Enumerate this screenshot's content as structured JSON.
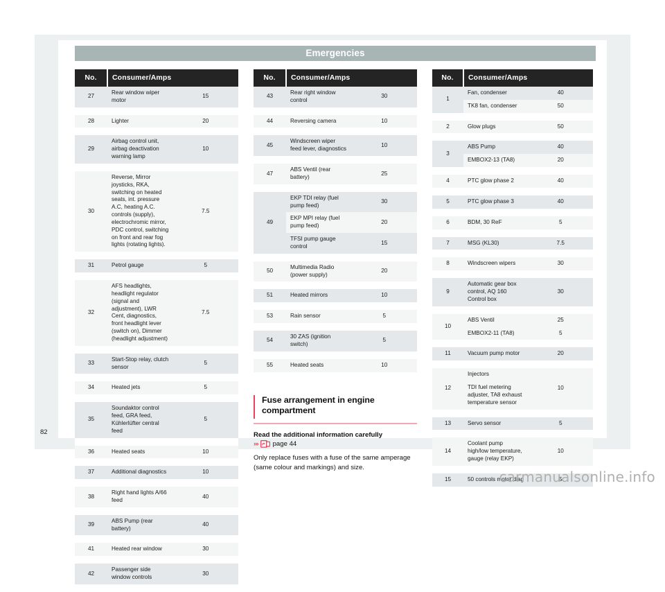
{
  "header": {
    "chapter_title": "Emergencies"
  },
  "folio": {
    "page_number": "82"
  },
  "watermark": {
    "text": "carmanualsonline.info"
  },
  "table_headers": {
    "no": "No.",
    "consumer": "Consumer/Amps"
  },
  "colors": {
    "header_bar": "#a7b5b5",
    "table_header": "#242424",
    "accent_red": "#e8415a",
    "row_dark": "#e4e8ea",
    "row_light": "#f4f6f6",
    "page_backdrop": "#edf0f1"
  },
  "tables": [
    {
      "id": "fuse-table-1",
      "rows": [
        {
          "no": "27",
          "items": [
            {
              "name": "Rear window wiper motor",
              "amps": "15"
            }
          ]
        },
        {
          "no": "28",
          "items": [
            {
              "name": "Lighter",
              "amps": "20"
            }
          ]
        },
        {
          "no": "29",
          "items": [
            {
              "name": "Airbag control unit, airbag deactivation warning lamp",
              "amps": "10"
            }
          ]
        },
        {
          "no": "30",
          "items": [
            {
              "name": "Reverse, Mirror joysticks, RKA, switching on heated seats, int. pressure A.C, heating A.C. controls (supply), electrochromic mirror, PDC control, switching on front and rear fog lights (rotating lights).",
              "amps": "7.5"
            }
          ]
        },
        {
          "no": "31",
          "items": [
            {
              "name": "Petrol gauge",
              "amps": "5"
            }
          ]
        },
        {
          "no": "32",
          "items": [
            {
              "name": "AFS headlights, headlight regulator (signal and adjustment), LWR Cent, diagnostics, front headlight lever (switch on), Dimmer (headlight adjustment)",
              "amps": "7.5"
            }
          ]
        },
        {
          "no": "33",
          "items": [
            {
              "name": "Start-Stop relay, clutch sensor",
              "amps": "5"
            }
          ]
        },
        {
          "no": "34",
          "items": [
            {
              "name": "Heated jets",
              "amps": "5"
            }
          ]
        },
        {
          "no": "35",
          "items": [
            {
              "name": "Soundaktor control feed, GRA feed, Kühlerlüfter central feed",
              "amps": "5"
            }
          ]
        },
        {
          "no": "36",
          "items": [
            {
              "name": "Heated seats",
              "amps": "10"
            }
          ]
        },
        {
          "no": "37",
          "items": [
            {
              "name": "Additional diagnostics",
              "amps": "10"
            }
          ]
        },
        {
          "no": "38",
          "items": [
            {
              "name": "Right hand lights A/66 feed",
              "amps": "40"
            }
          ]
        },
        {
          "no": "39",
          "items": [
            {
              "name": "ABS Pump (rear battery)",
              "amps": "40"
            }
          ]
        },
        {
          "no": "41",
          "items": [
            {
              "name": "Heated rear window",
              "amps": "30"
            }
          ]
        },
        {
          "no": "42",
          "items": [
            {
              "name": "Passenger side window controls",
              "amps": "30"
            }
          ]
        }
      ]
    },
    {
      "id": "fuse-table-2",
      "rows": [
        {
          "no": "43",
          "items": [
            {
              "name": "Rear right window control",
              "amps": "30"
            }
          ]
        },
        {
          "no": "44",
          "items": [
            {
              "name": "Reversing camera",
              "amps": "10"
            }
          ]
        },
        {
          "no": "45",
          "items": [
            {
              "name": "Windscreen wiper feed lever, diagnostics",
              "amps": "10"
            }
          ]
        },
        {
          "no": "47",
          "items": [
            {
              "name": "ABS Ventil (rear battery)",
              "amps": "25"
            }
          ]
        },
        {
          "no": "49",
          "items": [
            {
              "name": "EKP TDI relay (fuel pump feed)",
              "amps": "30"
            },
            {
              "name": "EKP MPI relay (fuel pump feed)",
              "amps": "20"
            },
            {
              "name": "TFSI pump gauge control",
              "amps": "15"
            }
          ]
        },
        {
          "no": "50",
          "items": [
            {
              "name": "Multimedia Radio (power supply)",
              "amps": "20"
            }
          ]
        },
        {
          "no": "51",
          "items": [
            {
              "name": "Heated mirrors",
              "amps": "10"
            }
          ]
        },
        {
          "no": "53",
          "items": [
            {
              "name": "Rain sensor",
              "amps": "5"
            }
          ]
        },
        {
          "no": "54",
          "items": [
            {
              "name": "30 ZAS (ignition switch)",
              "amps": "5"
            }
          ]
        },
        {
          "no": "55",
          "items": [
            {
              "name": "Heated seats",
              "amps": "10"
            }
          ]
        }
      ]
    },
    {
      "id": "fuse-table-3",
      "rows": [
        {
          "no": "1",
          "items": [
            {
              "name": "Fan, condenser",
              "amps": "40"
            },
            {
              "name": "TK8 fan, condenser",
              "amps": "50"
            }
          ]
        },
        {
          "no": "2",
          "items": [
            {
              "name": "Glow plugs",
              "amps": "50"
            }
          ]
        },
        {
          "no": "3",
          "items": [
            {
              "name": "ABS Pump",
              "amps": "40"
            },
            {
              "name": "EMBOX2-13 (TA8)",
              "amps": "20"
            }
          ]
        },
        {
          "no": "4",
          "items": [
            {
              "name": "PTC glow phase 2",
              "amps": "40"
            }
          ]
        },
        {
          "no": "5",
          "items": [
            {
              "name": "PTC glow phase 3",
              "amps": "40"
            }
          ]
        },
        {
          "no": "6",
          "items": [
            {
              "name": "BDM, 30 ReF",
              "amps": "5"
            }
          ]
        },
        {
          "no": "7",
          "items": [
            {
              "name": "MSG (KL30)",
              "amps": "7.5"
            }
          ]
        },
        {
          "no": "8",
          "items": [
            {
              "name": "Windscreen wipers",
              "amps": "30"
            }
          ]
        },
        {
          "no": "9",
          "items": [
            {
              "name": "Automatic gear box control, AQ 160 Control box",
              "amps": "30"
            }
          ]
        },
        {
          "no": "10",
          "items": [
            {
              "name": "ABS Ventil",
              "amps": "25"
            },
            {
              "name": "EMBOX2-11 (TA8)",
              "amps": "5"
            }
          ]
        },
        {
          "no": "11",
          "items": [
            {
              "name": "Vacuum pump motor",
              "amps": "20"
            }
          ]
        },
        {
          "no": "12",
          "shared_amps": "10",
          "items": [
            {
              "name": "Injectors"
            },
            {
              "name": "TDI fuel metering adjuster, TA8 exhaust temperature sensor"
            }
          ]
        },
        {
          "no": "13",
          "items": [
            {
              "name": "Servo sensor",
              "amps": "5"
            }
          ]
        },
        {
          "no": "14",
          "items": [
            {
              "name": "Coolant pump high/low temperature, gauge (relay EKP)",
              "amps": "10"
            }
          ]
        },
        {
          "no": "15",
          "items": [
            {
              "name": "50 controls motor diag",
              "amps": "5"
            }
          ]
        }
      ]
    }
  ],
  "article": {
    "heading": "Fuse arrangement in engine compartment",
    "lead": "Read the additional information carefully",
    "xref_chevrons": "›››",
    "xref_page": "page 44",
    "body": "Only replace fuses with a fuse of the same amperage (same colour and markings) and size."
  }
}
